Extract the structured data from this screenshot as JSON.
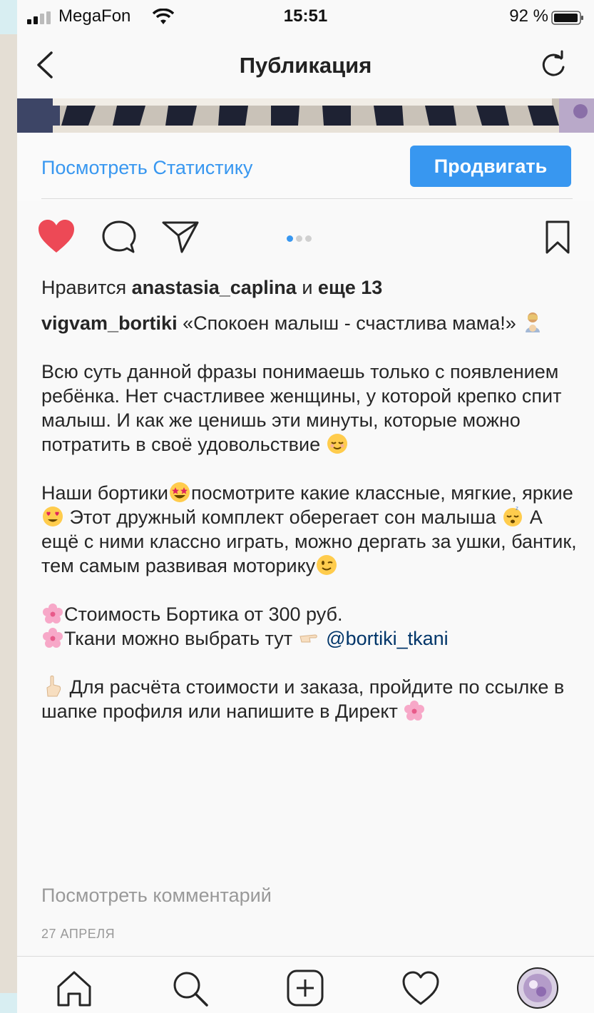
{
  "status_bar": {
    "carrier": "MegaFon",
    "time": "15:51",
    "battery": "92 %"
  },
  "nav": {
    "title": "Публикация"
  },
  "promo": {
    "stats_label": "Посмотреть Статистику",
    "boost_label": "Продвигать"
  },
  "post": {
    "likes_prefix": "Нравится",
    "likes_user": "anastasia_caplina",
    "likes_and": "и",
    "likes_more": "еще 13",
    "author": "vigvam_bortiki",
    "caption_line1": "«Спокоен малыш - счастлива мама!»",
    "para1": "Всю суть данной фразы понимаешь только с появлением ребёнка. Нет счастливее женщины, у которой крепко спит малыш. И как же ценишь эти минуты, которые можно потратить в своё удовольствие",
    "para2_a": "Наши бортики",
    "para2_b": "посмотрите какие классные, мягкие, яркие",
    "para2_c": " Этот дружный комплект оберегает сон малыша",
    "para2_d": " А ещё с ними классно играть, можно дергать за ушки, бантик, тем самым развивая моторику",
    "price_line": "Стоимость Бортика от 300 руб.",
    "fabric_line": "Ткани можно выбрать тут",
    "fabric_mention": "@bortiki_tkani",
    "order_line": "Для расчёта стоимости и заказа, пройдите по ссылке в шапке профиля или напишите в Директ",
    "view_comments": "Посмотреть комментарий",
    "date": "27 АПРЕЛЯ"
  },
  "icons": {
    "status": [
      "signal-icon",
      "wifi-icon",
      "battery-icon"
    ],
    "nav": [
      "back-chevron-icon",
      "refresh-icon"
    ],
    "actions": [
      "heart-icon",
      "comment-icon",
      "share-icon",
      "bookmark-icon"
    ],
    "tabs": [
      "home-icon",
      "search-icon",
      "add-post-icon",
      "activity-heart-icon",
      "profile-avatar"
    ]
  },
  "colors": {
    "accent": "#3897f0",
    "like": "#ed4956",
    "text": "#262626",
    "muted": "#999999",
    "mention": "#003569"
  },
  "carousel": {
    "count": 3,
    "active": 1
  }
}
